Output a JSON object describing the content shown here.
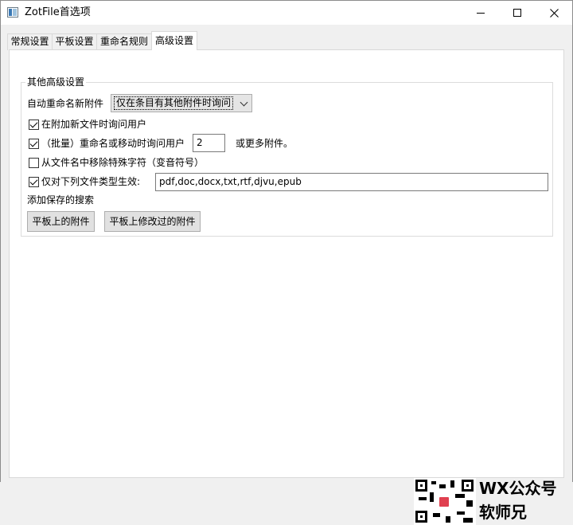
{
  "window": {
    "title": "ZotFile首选项"
  },
  "tabs": [
    {
      "label": "常规设置",
      "active": false
    },
    {
      "label": "平板设置",
      "active": false
    },
    {
      "label": "重命名规则",
      "active": false
    },
    {
      "label": "高级设置",
      "active": true
    }
  ],
  "group": {
    "title": "其他高级设置",
    "auto_rename": {
      "label": "自动重命名新附件",
      "selected": "仅在条目有其他附件时询问"
    },
    "ask_on_attach": {
      "label": "在附加新文件时询问用户",
      "checked": true
    },
    "batch_rename": {
      "label": "（批量）重命名或移动时询问用户",
      "checked": true,
      "value": "2",
      "suffix": "或更多附件。"
    },
    "remove_special": {
      "label": "从文件名中移除特殊字符（变音符号）",
      "checked": false
    },
    "file_types": {
      "label": "仅对下列文件类型生效:",
      "checked": true,
      "value": "pdf,doc,docx,txt,rtf,djvu,epub"
    },
    "saved_searches": {
      "label": "添加保存的搜索",
      "buttons": [
        "平板上的附件",
        "平板上修改过的附件"
      ]
    }
  },
  "watermark": {
    "line1": "WX公众号",
    "line2": "软师兄"
  }
}
